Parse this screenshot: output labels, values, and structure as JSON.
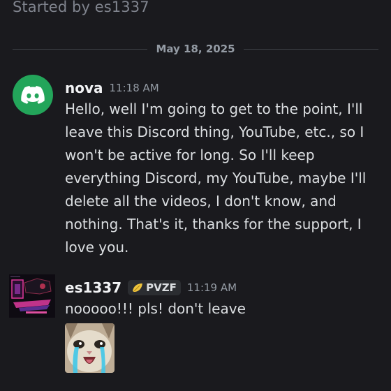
{
  "thread": {
    "started_by": "Started by es1337"
  },
  "divider": {
    "date": "May 18, 2025"
  },
  "messages": [
    {
      "username": "nova",
      "time": "11:18 AM",
      "avatar_icon": "discord-logo-icon",
      "text": "Hello, well I'm going to get to the point, I'll leave this Discord thing, YouTube, etc., so I won't be active for long. So I'll keep everything Discord, my YouTube, maybe I'll delete all the videos, I don't know, and nothing. That's it, thanks for the support, I love you."
    },
    {
      "username": "es1337",
      "tag": "PVZF",
      "tag_icon": "leaf-badge-icon",
      "time": "11:19 AM",
      "text": "nooooo!!! pls! don't leave",
      "attachment": "crying-cat-image"
    }
  ],
  "colors": {
    "background": "#1a1a1e",
    "discord_green": "#23a55a",
    "tag_leaf": "#f0c53c"
  }
}
